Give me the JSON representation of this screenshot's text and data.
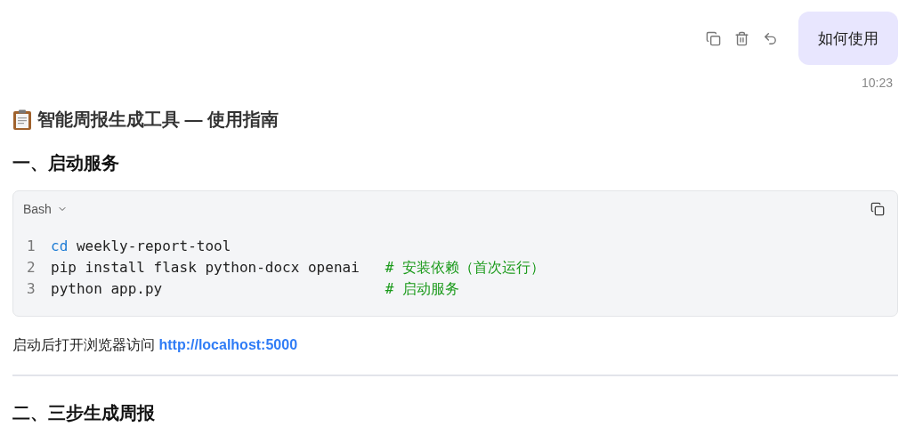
{
  "user_message": {
    "text": "如何使用",
    "time": "10:23"
  },
  "reply": {
    "title": "智能周报生成工具 — 使用指南",
    "section_1": "一、启动服务",
    "code_block": {
      "language": "Bash",
      "lines": [
        {
          "number": "1",
          "tokens": [
            {
              "kind": "keyword",
              "text": "cd"
            },
            {
              "kind": "plain",
              "text": " weekly-report-tool"
            }
          ]
        },
        {
          "number": "2",
          "tokens": [
            {
              "kind": "plain",
              "text": "pip install flask python-docx openai   "
            },
            {
              "kind": "comment",
              "text": "# 安装依赖（首次运行）"
            }
          ]
        },
        {
          "number": "3",
          "tokens": [
            {
              "kind": "plain",
              "text": "python app.py                          "
            },
            {
              "kind": "comment",
              "text": "# 启动服务"
            }
          ]
        }
      ]
    },
    "paragraph": {
      "text": "启动后打开浏览器访问",
      "link": "http://localhost:5000"
    },
    "section_2": "二、三步生成周报"
  }
}
